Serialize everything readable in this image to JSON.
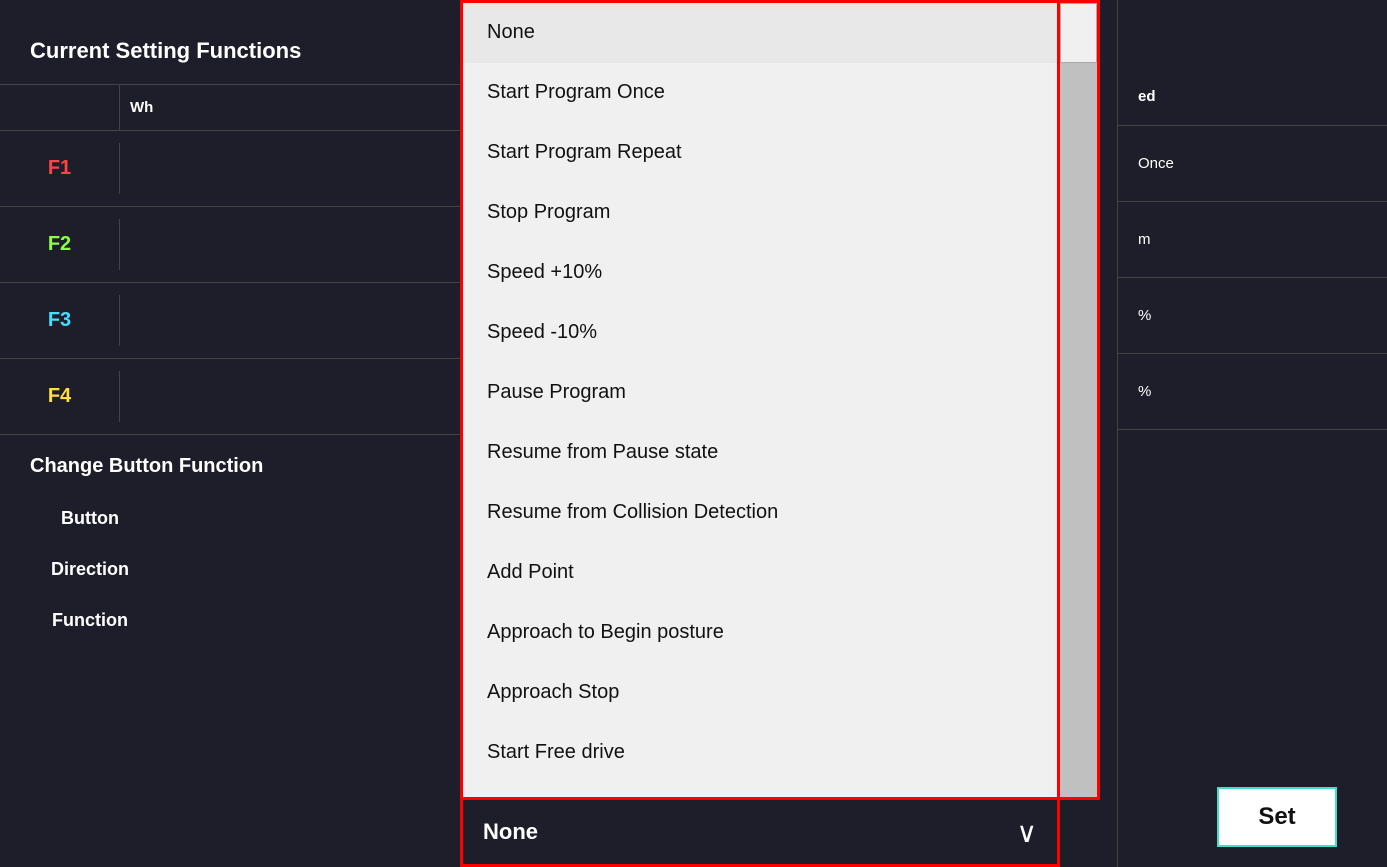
{
  "page": {
    "background_color": "#1e1e2a"
  },
  "current_setting": {
    "title": "Current Setting Functions",
    "table": {
      "header": {
        "col1": "",
        "col2": "Wh",
        "col3": "ed"
      },
      "rows": [
        {
          "key": "F1",
          "key_color": "f1",
          "val_right": "Once"
        },
        {
          "key": "F2",
          "key_color": "f2",
          "val_right": "m"
        },
        {
          "key": "F3",
          "key_color": "f3",
          "val_right": "%"
        },
        {
          "key": "F4",
          "key_color": "f4",
          "val_right": "%"
        }
      ]
    }
  },
  "change_button": {
    "title": "Change Button Function",
    "fields": [
      {
        "label": "Button"
      },
      {
        "label": "Direction"
      },
      {
        "label": "Function"
      }
    ]
  },
  "dropdown": {
    "items": [
      {
        "id": "none",
        "label": "None"
      },
      {
        "id": "start-once",
        "label": "Start Program Once"
      },
      {
        "id": "start-repeat",
        "label": "Start Program Repeat"
      },
      {
        "id": "stop",
        "label": "Stop Program"
      },
      {
        "id": "speed-plus",
        "label": "Speed +10%"
      },
      {
        "id": "speed-minus",
        "label": "Speed -10%"
      },
      {
        "id": "pause",
        "label": "Pause Program"
      },
      {
        "id": "resume-pause",
        "label": "Resume from Pause state"
      },
      {
        "id": "resume-collision",
        "label": "Resume from Collision Detection"
      },
      {
        "id": "add-point",
        "label": "Add Point"
      },
      {
        "id": "approach-begin",
        "label": "Approach to Begin posture"
      },
      {
        "id": "approach-stop",
        "label": "Approach Stop"
      },
      {
        "id": "free-drive",
        "label": "Start Free drive"
      }
    ],
    "selected_label": "None",
    "chevron": "∨"
  },
  "set_button": {
    "label": "Set"
  }
}
